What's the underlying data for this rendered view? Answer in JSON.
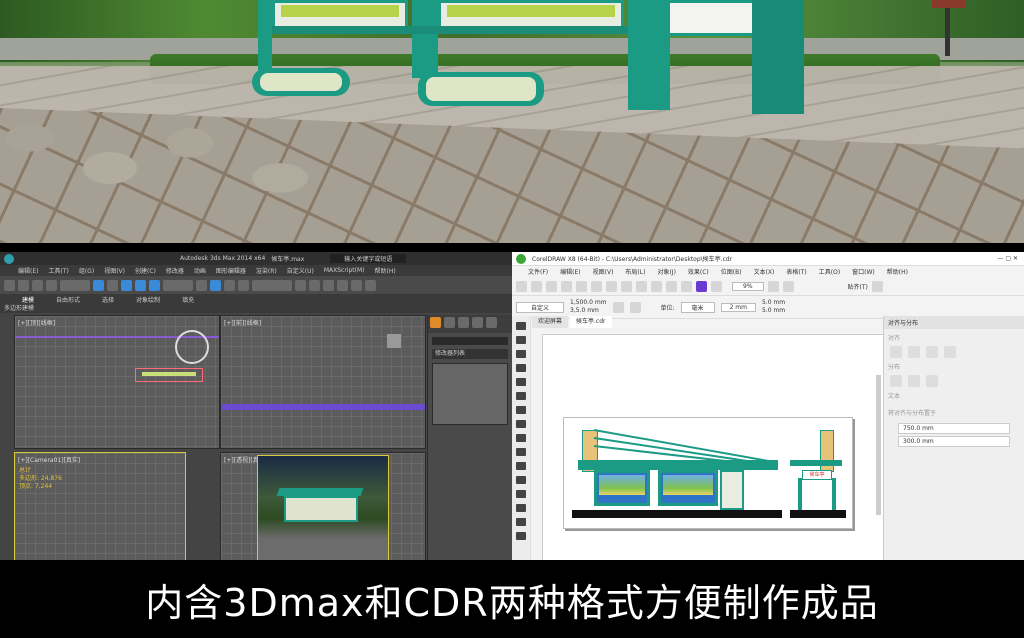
{
  "caption": "内含3Dmax和CDR两种格式方便制作成品",
  "max": {
    "window_title": "Autodesk 3ds Max 2014 x64",
    "file_name": "候车亭.max",
    "search_placeholder": "输入关键字或短语",
    "menus": [
      "编辑(E)",
      "工具(T)",
      "组(G)",
      "视图(V)",
      "创建(C)",
      "修改器",
      "动画",
      "图形编辑器",
      "渲染(R)",
      "自定义(U)",
      "MAXScript(M)",
      "帮助(H)"
    ],
    "tabs": [
      "建模",
      "自由形式",
      "选择",
      "对象绘制",
      "填充"
    ],
    "ribbon_label": "多边形建模",
    "viewports": {
      "top_left": "[+][顶][线框]",
      "top_right": "[+][前][线框]",
      "bottom_left": "[+][Camera01][真实]",
      "bottom_right": "[+][透视][真实]"
    },
    "stats": {
      "label_total": "总计",
      "polys": "多边形: 24,876",
      "verts": "顶点: 7,244"
    },
    "modifier_list": "修改器列表",
    "colors": {
      "accent": "#3b8ad8",
      "active_border": "#d6c93a"
    }
  },
  "cdr": {
    "window_title": "CorelDRAW X8 (64-Bit) - C:\\Users\\Administrator\\Desktop\\候车亭.cdr",
    "menus": [
      "文件(F)",
      "编辑(E)",
      "视图(V)",
      "布局(L)",
      "对象(J)",
      "效果(C)",
      "位图(B)",
      "文本(X)",
      "表格(T)",
      "工具(O)",
      "窗口(W)",
      "帮助(H)"
    ],
    "zoom": "9%",
    "snap_label": "贴齐(T)",
    "page_size": "自定义",
    "width_value": "1,500.0 mm",
    "height_value": "3,5.0 mm",
    "units_label": "单位:",
    "units_value": "毫米",
    "nudge_value": "2 mm",
    "dup_x": "5.0 mm",
    "dup_y": "5.0 mm",
    "doc_tabs": [
      "欢迎屏幕",
      "候车亭.cdr"
    ],
    "docker_title": "对齐与分布",
    "docker_sections": [
      "对齐",
      "分布",
      "文本",
      "将对齐与分布置于"
    ],
    "docker_x": "750.0 mm",
    "docker_y": "300.0 mm",
    "shelter_sign": "候车亭",
    "colors": {
      "teal": "#1c9b84",
      "panel_blue": "#2f73c6",
      "ground": "#111111"
    }
  },
  "render": {
    "colors": {
      "steel": "#1c9b84",
      "panel": "#e9ece1",
      "lightbox": "#b7d34a"
    }
  }
}
